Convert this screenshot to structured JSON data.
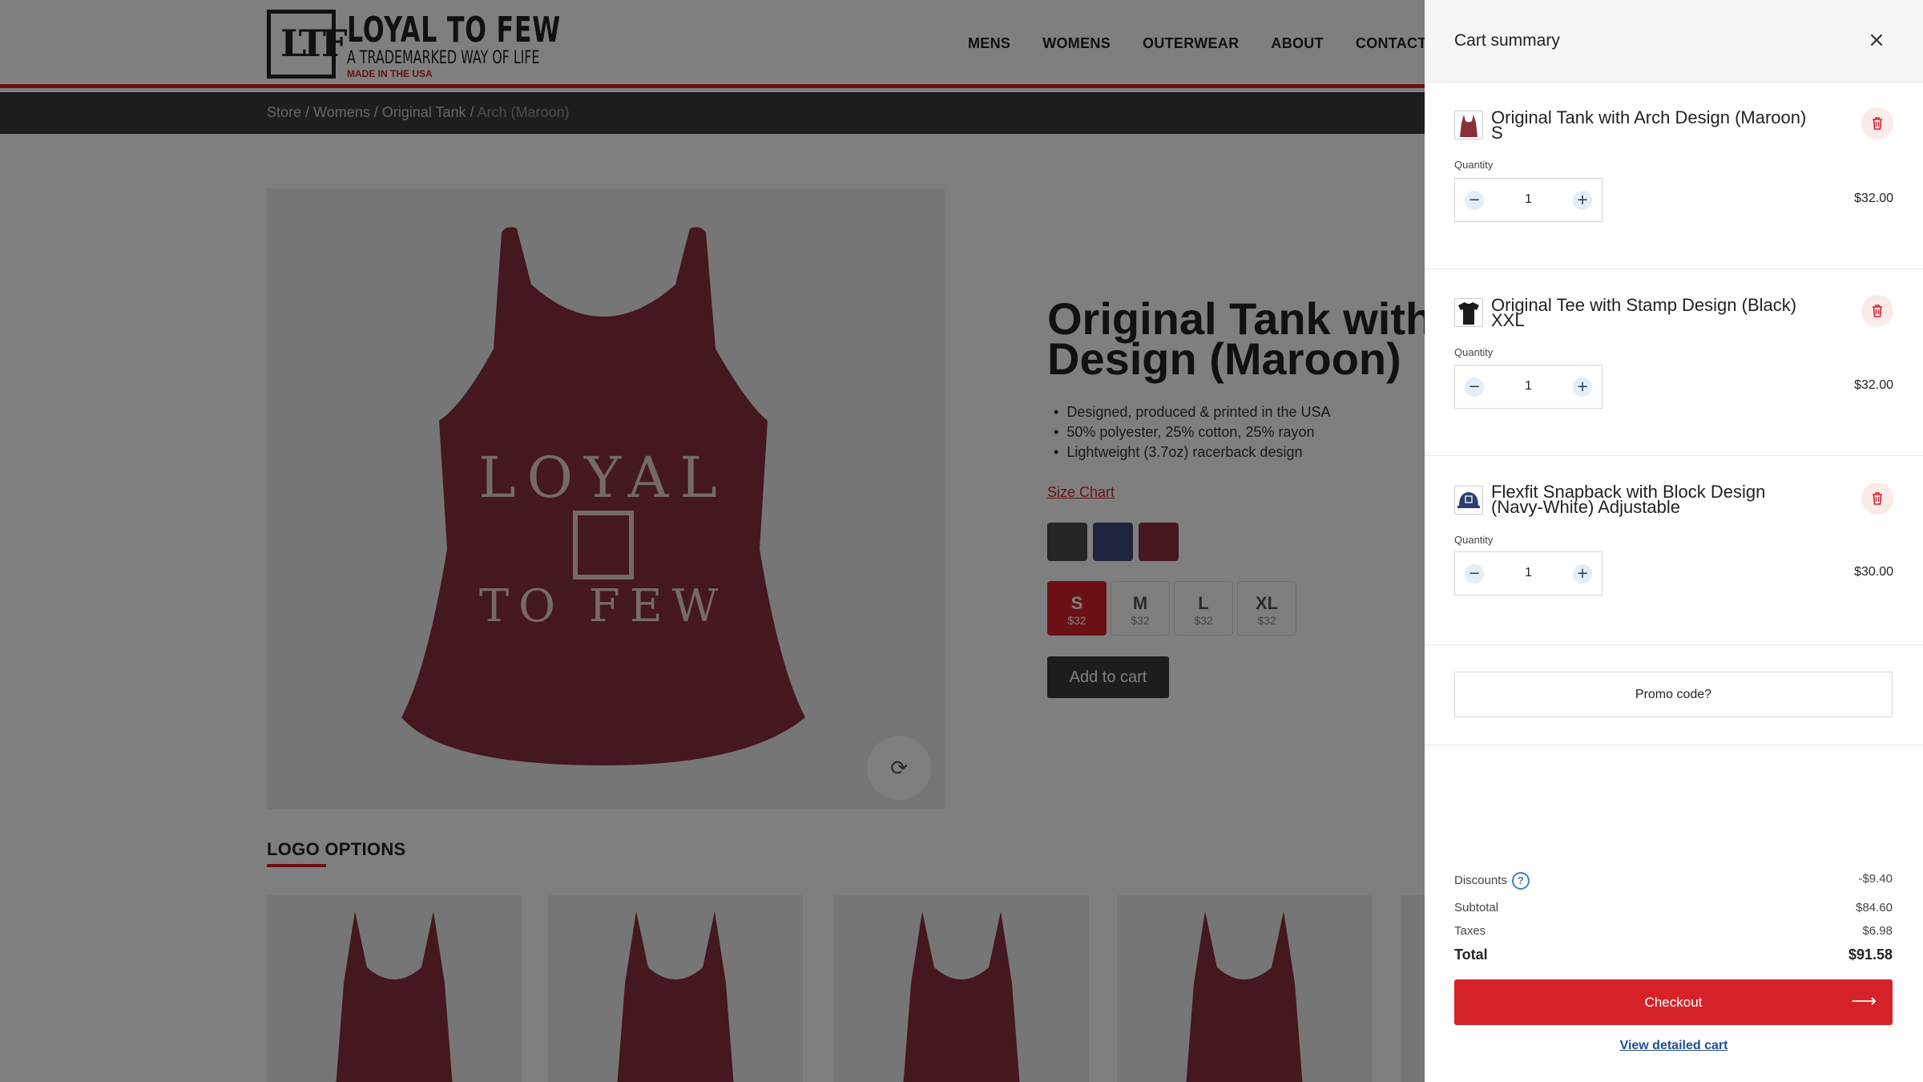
{
  "header": {
    "logo_title": "LOYAL TO FEW",
    "logo_tagline": "A TRADEMARKED WAY OF LIFE",
    "logo_made": "MADE IN THE USA",
    "logo_mark": "LTF",
    "nav": [
      "MENS",
      "WOMENS",
      "OUTERWEAR",
      "ABOUT",
      "CONTACT"
    ]
  },
  "breadcrumb": {
    "store": "Store",
    "womens": "Womens",
    "product": "Original Tank",
    "current": "Arch (Maroon)",
    "sep": " / "
  },
  "product": {
    "title_line1": "Original Tank with",
    "title_line2": "Design (Maroon)",
    "bullets": [
      "Designed, produced & printed in the USA",
      "50% polyester, 25% cotton, 25% rayon",
      "Lightweight (3.7oz) racerback design"
    ],
    "size_chart": "Size Chart",
    "swatches": [
      "#4a4a4c",
      "#3d4a7a",
      "#8a2f3c"
    ],
    "sizes": [
      {
        "label": "S",
        "price": "$32"
      },
      {
        "label": "M",
        "price": "$32"
      },
      {
        "label": "L",
        "price": "$32"
      },
      {
        "label": "XL",
        "price": "$32"
      }
    ],
    "add_to_cart": "Add to cart",
    "logo_options": "LOGO OPTIONS"
  },
  "cart": {
    "title": "Cart summary",
    "close_icon": "×",
    "quantity_label": "Quantity",
    "items": [
      {
        "name_line1": "Original Tank with Arch Design (Maroon)",
        "name_line2": "S",
        "qty": "1",
        "price": "$32.00"
      },
      {
        "name_line1": "Original Tee with Stamp Design (Black)",
        "name_line2": "XXL",
        "qty": "1",
        "price": "$32.00"
      },
      {
        "name_line1": "Flexfit Snapback with Block Design",
        "name_line2": "(Navy-White) Adjustable",
        "qty": "1",
        "price": "$30.00"
      }
    ],
    "promo": "Promo code?",
    "discounts_label": "Discounts",
    "discounts_value": "-$9.40",
    "subtotal_label": "Subtotal",
    "subtotal_value": "$84.60",
    "taxes_label": "Taxes",
    "taxes_value": "$6.98",
    "total_label": "Total",
    "total_value": "$91.58",
    "checkout": "Checkout",
    "view_detailed": "View detailed cart"
  },
  "colors": {
    "accent": "#d6232a",
    "maroon": "#8a2f3c",
    "dark": "#3a3a3c"
  }
}
